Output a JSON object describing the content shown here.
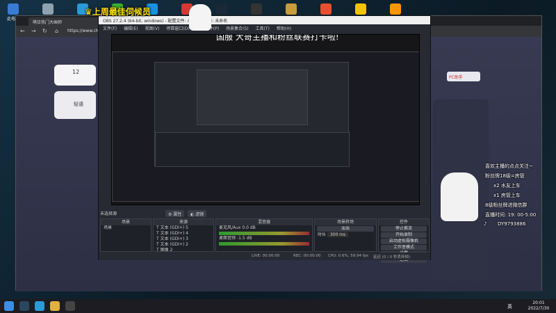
{
  "desktop": {
    "icons": [
      {
        "label": "此电脑",
        "icon": "computer-icon",
        "color": "#3a7bd5"
      },
      {
        "label": "回收站",
        "icon": "recycle-bin-icon",
        "color": "#8fa2b0"
      },
      {
        "label": "Microsoft Edge",
        "icon": "edge-icon",
        "color": "#2b9ad8"
      },
      {
        "label": "微信",
        "icon": "wechat-icon",
        "color": "#3cb034"
      },
      {
        "label": "QQ",
        "icon": "qq-icon",
        "color": "#1a90e0"
      },
      {
        "label": "网易云",
        "icon": "music-icon",
        "color": "#d33a31"
      },
      {
        "label": "Steam",
        "icon": "steam-icon",
        "color": "#1b2838"
      },
      {
        "label": "OBS",
        "icon": "obs-icon",
        "color": "#333"
      },
      {
        "label": "英雄联盟",
        "icon": "game-icon",
        "color": "#c89b3c"
      },
      {
        "label": "WeGame",
        "icon": "wegame-icon",
        "color": "#e94f2f"
      },
      {
        "label": "YY",
        "icon": "yy-icon",
        "color": "#f5c400"
      },
      {
        "label": "虎牙直播",
        "icon": "huya-icon",
        "color": "#ff9600"
      }
    ]
  },
  "banner": {
    "text": "上周最佳伺候员",
    "crown_icon": "crown-icon"
  },
  "browser": {
    "tab_title": "萌日热门大画师",
    "url": "https://www.chou",
    "page_badge": "PC助手",
    "card_number": "12",
    "card_text": "轻语"
  },
  "obs": {
    "title": "OBS 27.2.4 (64-bit, windows) - 配置文件: 未命名 - 场景: 未命名",
    "menu": [
      "文件(F)",
      "编辑(E)",
      "视图(V)",
      "停靠窗口(D)",
      "配置文件(P)",
      "场景集合(S)",
      "工具(T)",
      "帮助(H)"
    ],
    "stream_title": "国服 大哥主播和粉丝联赛打卡啦!",
    "scene_label": "未选择源",
    "prop_button": "属性",
    "filter_button": "滤镜",
    "docks": {
      "scenes": {
        "title": "场景",
        "items": [
          "场景"
        ]
      },
      "sources": {
        "title": "来源",
        "items": [
          "文本 (GDI+) 5",
          "文本 (GDI+) 4",
          "文本 (GDI+) 3",
          "文本 (GDI+) 2",
          "图像 2",
          "图像"
        ]
      },
      "mixer": {
        "title": "混音器",
        "tracks": [
          {
            "name": "麦克风/Aux",
            "db": "0.0 dB"
          },
          {
            "name": "桌面音频",
            "db": "-1.5 dB"
          }
        ]
      },
      "transitions": {
        "title": "场景转场",
        "type": "淡出",
        "duration_label": "时长",
        "duration": "300 ms"
      },
      "controls": {
        "title": "控件",
        "buttons": [
          "停止推流",
          "开始录制",
          "启动虚拟摄像机",
          "工作室模式",
          "设置",
          "退出"
        ]
      }
    },
    "status": {
      "live": "LIVE: 00:00:00",
      "rec": "REC: 00:00:00",
      "cpu": "CPU: 0.6%, 59.94 fps",
      "dropped": "延迟 (0 / 0 秒丢弃帧)"
    }
  },
  "overlay": {
    "line1": "喜欢主播的点点关注~",
    "line2": "粉丝牌18级=房管",
    "line3": "x2 水友上车",
    "line4": "x1 房管上车",
    "line5": "8级粉丝牌进微信群",
    "line6": "直播时间: 19: 00-5:00",
    "tiktok_id": "DY9793886",
    "tiktok_icon": "tiktok-icon"
  },
  "taskbar": {
    "time": "20:01",
    "date": "2022/7/30",
    "ime": "英",
    "apps": [
      {
        "icon": "windows-start-icon",
        "color": "#3a8ee6"
      },
      {
        "icon": "steam-icon",
        "color": "#2a475e"
      },
      {
        "icon": "edge-icon",
        "color": "#2b9ad8"
      },
      {
        "icon": "folder-icon",
        "color": "#e0b040"
      },
      {
        "icon": "obs-icon",
        "color": "#444"
      }
    ]
  }
}
